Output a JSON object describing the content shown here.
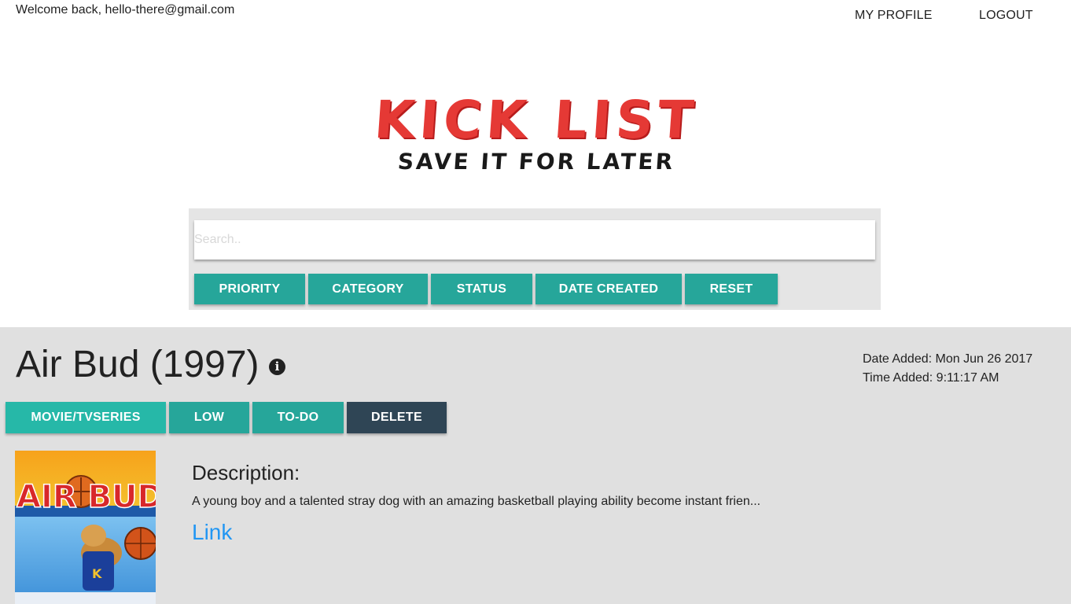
{
  "header": {
    "welcome_text": "Welcome back, hello-there@gmail.com",
    "nav": {
      "profile_label": "MY PROFILE",
      "logout_label": "LOGOUT"
    }
  },
  "logo": {
    "title": "KICK LIST",
    "subtitle": "SAVE IT FOR LATER"
  },
  "search": {
    "placeholder": "Search..",
    "value": ""
  },
  "filters": {
    "priority_label": "PRIORITY",
    "category_label": "CATEGORY",
    "status_label": "STATUS",
    "date_created_label": "DATE CREATED",
    "reset_label": "RESET"
  },
  "item": {
    "title": "Air Bud (1997)",
    "info_icon": "info-circle-icon",
    "date_added": "Date Added: Mon Jun 26 2017",
    "time_added": "Time Added: 9:11:17 AM",
    "tags": {
      "category": "MOVIE/TVSERIES",
      "priority": "LOW",
      "status": "TO-DO",
      "delete": "DELETE"
    },
    "poster_text": "AIR BUD",
    "description_heading": "Description:",
    "description": "A young boy and a talented stray dog with an amazing basketball playing ability become instant frien...",
    "link_label": "Link"
  },
  "colors": {
    "teal": "#26a69a",
    "teal_light": "#26b8a8",
    "delete_dark": "#2f4555",
    "logo_red": "#e53935",
    "link_blue": "#2196f3",
    "card_bg": "#e0e0e0",
    "panel_bg": "#e5e5e5"
  }
}
